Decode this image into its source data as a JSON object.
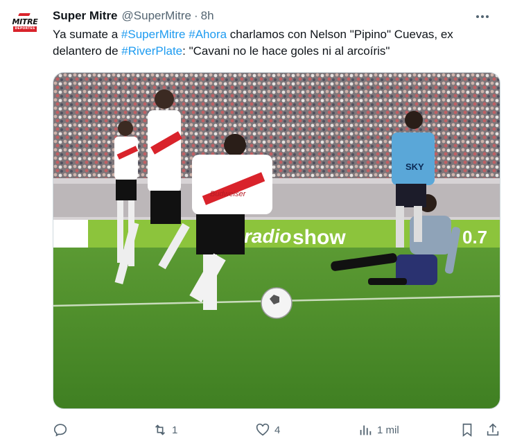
{
  "tweet": {
    "author_name": "Super Mitre",
    "handle": "@SuperMitre",
    "separator": "·",
    "time": "8h",
    "avatar": {
      "brand": "MITRE",
      "sub": "DEPORTES"
    },
    "text_segments": [
      {
        "text": "Ya sumate a ",
        "tag": false
      },
      {
        "text": "#SuperMitre",
        "tag": true
      },
      {
        "text": " ",
        "tag": false
      },
      {
        "text": "#Ahora",
        "tag": true
      },
      {
        "text": " charlamos con Nelson \"Pipino\" Cuevas, ex delantero de ",
        "tag": false
      },
      {
        "text": "#RiverPlate",
        "tag": true
      },
      {
        "text": ": \"Cavani no le hace goles ni al arcoíris\"",
        "tag": false
      }
    ]
  },
  "photo": {
    "banner_left": "radio",
    "banner_right": "show",
    "banner_end": "0.7",
    "jersey_sponsor": "Budweiser",
    "keeper_sponsor": "SKY"
  },
  "actions": {
    "reply_count": "",
    "retweet_count": "1",
    "like_count": "4",
    "views_count": "1 mil"
  },
  "colors": {
    "link": "#1d9bf0",
    "muted": "#536471",
    "text": "#0f1419",
    "river_red": "#d9232b",
    "keeper_blue": "#5aa7d8",
    "pitch_green": "#4f8f2a"
  },
  "icons": [
    "more-icon",
    "reply-icon",
    "retweet-icon",
    "like-icon",
    "views-icon",
    "bookmark-icon",
    "share-icon"
  ]
}
